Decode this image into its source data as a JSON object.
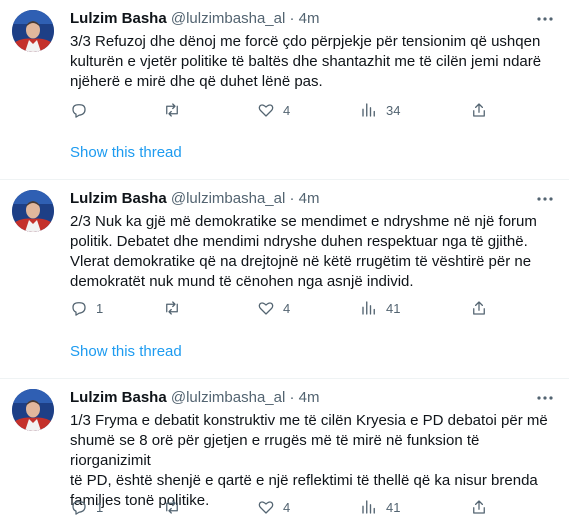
{
  "tweets": [
    {
      "author": "Lulzim Basha",
      "handle": "@lulzimbasha_al",
      "dot": "·",
      "time": "4m",
      "text": "3/3 Refuzoj dhe dënoj me forcë çdo përpjekje për tensionim që ushqen\nkulturën e vjetër politike të baltës dhe shantazhit me të cilën jemi ndarë\nnjëherë e mirë dhe që duhet lënë pas.",
      "reply_count": "",
      "retweet_count": "",
      "like_count": "4",
      "view_count": "34",
      "show_thread": "Show this thread"
    },
    {
      "author": "Lulzim Basha",
      "handle": "@lulzimbasha_al",
      "dot": "·",
      "time": "4m",
      "text": "2/3 Nuk ka gjë më demokratike se mendimet e ndryshme në një forum\npolitik. Debatet dhe mendimi ndryshe duhen respektuar nga të gjithë.\nVlerat demokratike që na drejtojnë në këtë rrugëtim të vështirë për ne\ndemokratët nuk mund të cënohen nga asnjë individ.",
      "reply_count": "1",
      "retweet_count": "",
      "like_count": "4",
      "view_count": "41",
      "show_thread": "Show this thread"
    },
    {
      "author": "Lulzim Basha",
      "handle": "@lulzimbasha_al",
      "dot": "·",
      "time": "4m",
      "text": "1/3 Fryma e debatit konstruktiv me të cilën Kryesia e PD debatoi për më\nshumë se 8 orë për gjetjen e rrugës më të mirë në funksion të riorganizimit\ntë PD, është shenjë e qartë e një reflektimi të thellë që ka nisur brenda\nfamiljes tonë politike.",
      "reply_count": "1",
      "retweet_count": "",
      "like_count": "4",
      "view_count": "41"
    }
  ]
}
